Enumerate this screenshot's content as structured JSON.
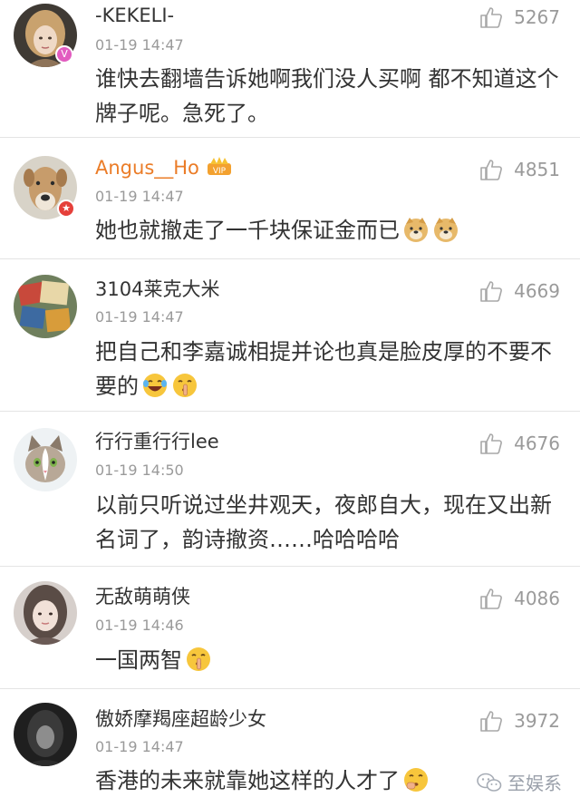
{
  "comments": [
    {
      "username": "-KEKELI-",
      "time": "01-19 14:47",
      "text": "谁快去翻墙告诉她啊我们没人买啊 都不知道这个牌子呢。急死了。",
      "likes": "5267",
      "avatar_icon": "girl-portrait-avatar",
      "badge_icon": "member-badge-icon",
      "badge_color": "#e25cc0"
    },
    {
      "username": "Angus__Ho",
      "time": "01-19 14:47",
      "text": "她也就撤走了一千块保证金而已",
      "likes": "4851",
      "avatar_icon": "dog-avatar",
      "badge_icon": "verified-star-icon",
      "badge_color": "#e5403a",
      "name_color": "#eb7c27"
    },
    {
      "username": "3104莱克大米",
      "time": "01-19 14:47",
      "text": "把自己和李嘉诚相提并论也真是脸皮厚的不要不要的",
      "likes": "4669",
      "avatar_icon": "books-avatar"
    },
    {
      "username": "行行重行行lee",
      "time": "01-19 14:50",
      "text": "以前只听说过坐井观天，夜郎自大，现在又出新名词了，韵诗撤资……哈哈哈哈",
      "likes": "4676",
      "avatar_icon": "cat-avatar"
    },
    {
      "username": "无敌萌萌侠",
      "time": "01-19 14:46",
      "text": "一国两智",
      "likes": "4086",
      "avatar_icon": "girl-avatar"
    },
    {
      "username": "傲娇摩羯座超龄少女",
      "time": "01-19 14:47",
      "text": "香港的未来就靠她这样的人才了",
      "likes": "3972",
      "avatar_icon": "dark-portrait-avatar"
    }
  ],
  "watermark": {
    "text": "至娱系",
    "icon": "wechat-icon"
  }
}
